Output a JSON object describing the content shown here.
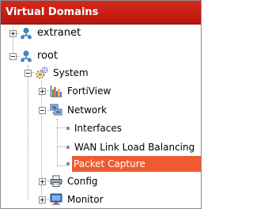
{
  "panel": {
    "title": "Virtual Domains"
  },
  "tree": {
    "extranet": "extranet",
    "root": "root",
    "system": "System",
    "fortiview": "FortiView",
    "network": "Network",
    "interfaces": "Interfaces",
    "wan_link": "WAN Link Load Balancing",
    "packet_capture": "Packet Capture",
    "config": "Config",
    "monitor": "Monitor"
  },
  "icons": {
    "vdom": "vdom-node-icon",
    "system": "gear-icon",
    "fortiview": "bar-chart-icon",
    "network": "network-computer-icon",
    "config": "printer-config-icon",
    "monitor": "monitor-icon"
  },
  "colors": {
    "title_bar": "#c41e14",
    "selected_row": "#f05a31"
  }
}
